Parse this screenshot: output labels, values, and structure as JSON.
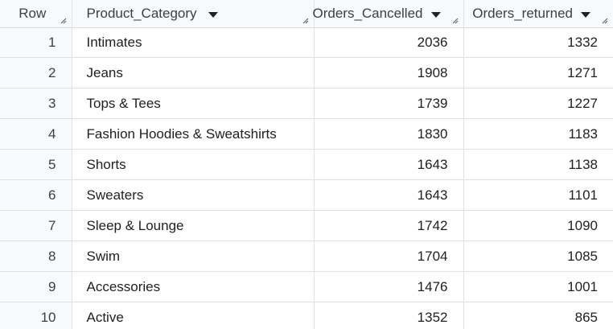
{
  "table": {
    "columns": [
      {
        "label": "Row"
      },
      {
        "label": "Product_Category"
      },
      {
        "label": "Orders_Cancelled"
      },
      {
        "label": "Orders_returned"
      }
    ],
    "rows": [
      {
        "row": "1",
        "category": "Intimates",
        "cancelled": "2036",
        "returned": "1332"
      },
      {
        "row": "2",
        "category": "Jeans",
        "cancelled": "1908",
        "returned": "1271"
      },
      {
        "row": "3",
        "category": "Tops & Tees",
        "cancelled": "1739",
        "returned": "1227"
      },
      {
        "row": "4",
        "category": "Fashion Hoodies & Sweatshirts",
        "cancelled": "1830",
        "returned": "1183"
      },
      {
        "row": "5",
        "category": "Shorts",
        "cancelled": "1643",
        "returned": "1138"
      },
      {
        "row": "6",
        "category": "Sweaters",
        "cancelled": "1643",
        "returned": "1101"
      },
      {
        "row": "7",
        "category": "Sleep & Lounge",
        "cancelled": "1742",
        "returned": "1090"
      },
      {
        "row": "8",
        "category": "Swim",
        "cancelled": "1704",
        "returned": "1085"
      },
      {
        "row": "9",
        "category": "Accessories",
        "cancelled": "1476",
        "returned": "1001"
      },
      {
        "row": "10",
        "category": "Active",
        "cancelled": "1352",
        "returned": "865"
      }
    ]
  }
}
